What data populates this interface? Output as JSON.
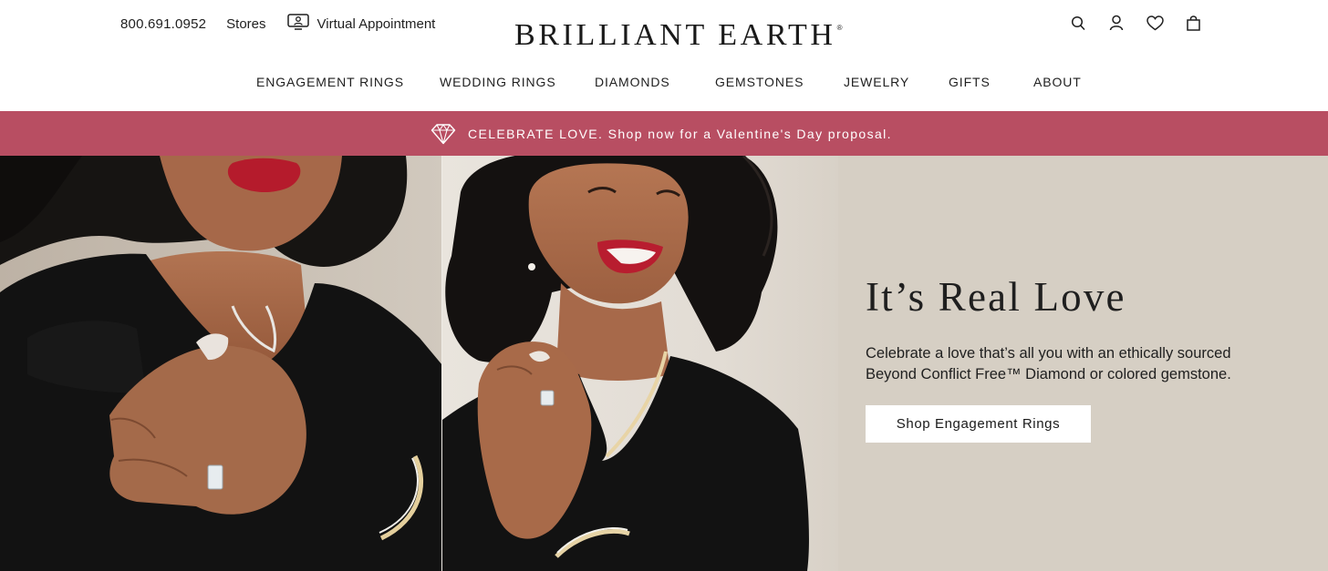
{
  "header": {
    "phone": "800.691.0952",
    "stores": "Stores",
    "virtual_appointment": "Virtual Appointment",
    "logo": "BRILLIANT EARTH",
    "logo_mark": "®",
    "icons": [
      "search-icon",
      "account-icon",
      "wishlist-heart-icon",
      "shopping-bag-icon"
    ]
  },
  "nav": {
    "items": [
      "ENGAGEMENT RINGS",
      "WEDDING RINGS",
      "DIAMONDS",
      "GEMSTONES",
      "JEWELRY",
      "GIFTS",
      "ABOUT"
    ]
  },
  "promo": {
    "icon": "diamond-icon",
    "text": "CELEBRATE LOVE. Shop now for a Valentine's Day proposal.",
    "background": "#b84e62"
  },
  "hero": {
    "title": "It’s Real Love",
    "subtitle": "Celebrate a love that’s all you with an ethically sourced Beyond Conflict Free™ Diamond or colored gemstone.",
    "cta": "Shop Engagement Rings",
    "background": "#d6cfc4"
  }
}
